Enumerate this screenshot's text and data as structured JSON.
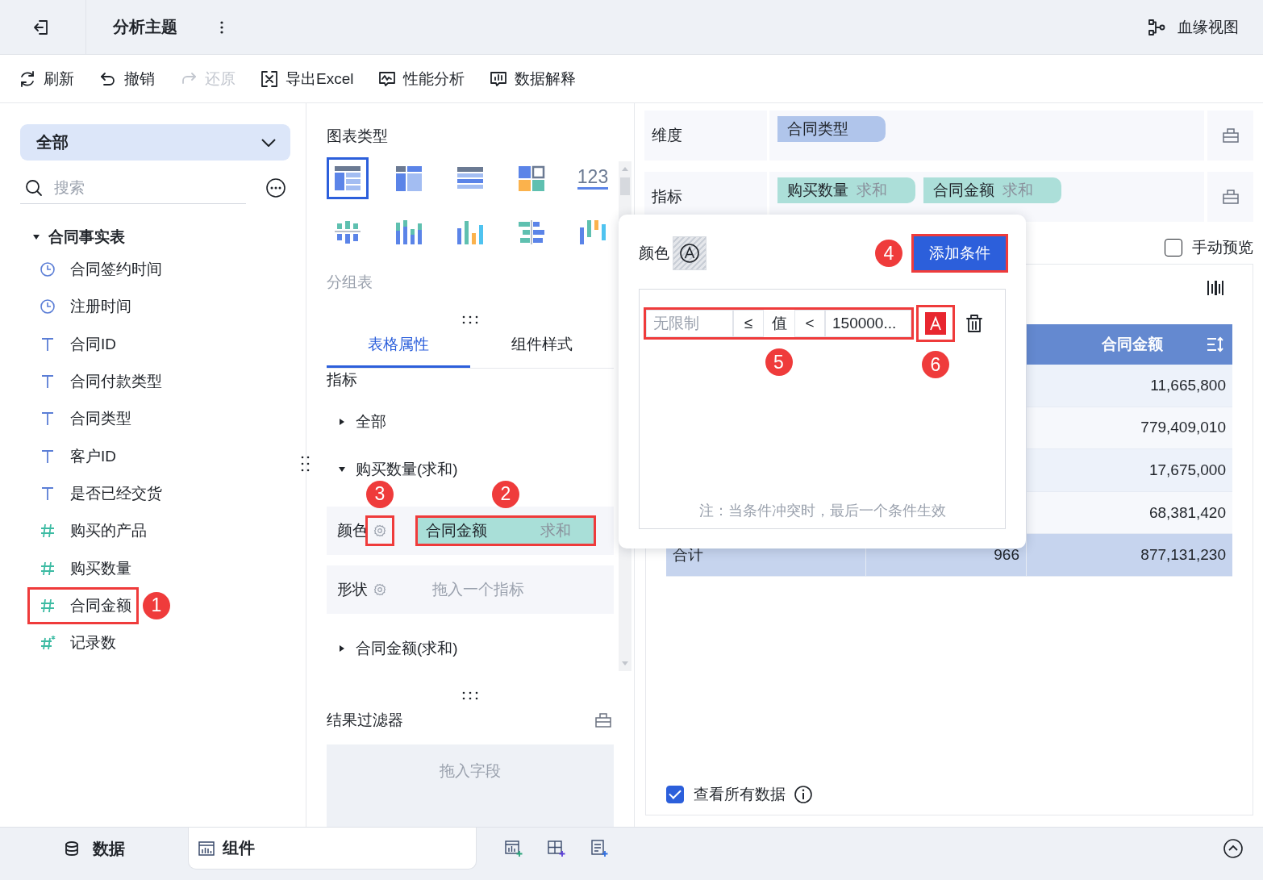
{
  "header": {
    "title": "分析主题",
    "lineage": "血缘视图"
  },
  "toolbar": [
    {
      "kind": "refresh",
      "label": "刷新",
      "disabled": false
    },
    {
      "kind": "undo",
      "label": "撤销",
      "disabled": false
    },
    {
      "kind": "redo",
      "label": "还原",
      "disabled": true
    },
    {
      "kind": "excel",
      "label": "导出Excel",
      "disabled": false
    },
    {
      "kind": "perf",
      "label": "性能分析",
      "disabled": false
    },
    {
      "kind": "explain",
      "label": "数据解释",
      "disabled": false
    }
  ],
  "fields_panel": {
    "scope": "全部",
    "search": {
      "placeholder": "搜索"
    },
    "tree": [
      {
        "label": "合同事实表",
        "expanded": true,
        "children": [
          {
            "label": "合同签约时间",
            "kind": "time"
          },
          {
            "label": "注册时间",
            "kind": "time"
          },
          {
            "label": "合同ID",
            "kind": "text"
          },
          {
            "label": "合同付款类型",
            "kind": "text"
          },
          {
            "label": "合同类型",
            "kind": "text"
          },
          {
            "label": "客户ID",
            "kind": "text"
          },
          {
            "label": "是否已经交货",
            "kind": "text"
          },
          {
            "label": "购买的产品",
            "kind": "number"
          },
          {
            "label": "购买数量",
            "kind": "number"
          },
          {
            "label": "合同金额",
            "kind": "number",
            "callout": "1"
          },
          {
            "label": "记录数",
            "kind": "calc"
          }
        ]
      }
    ]
  },
  "chart_types": {
    "title": "图表类型",
    "caption": "分组表",
    "items": [
      {
        "kind": "group-table",
        "selected": true
      },
      {
        "kind": "cross-table",
        "selected": false
      },
      {
        "kind": "detail-table",
        "selected": false
      },
      {
        "kind": "card",
        "selected": false
      },
      {
        "kind": "kpi",
        "label": "123",
        "selected": false
      },
      {
        "kind": "diverging",
        "selected": false
      },
      {
        "kind": "stacked",
        "selected": false
      },
      {
        "kind": "column",
        "selected": false
      },
      {
        "kind": "butterfly",
        "selected": false
      },
      {
        "kind": "waterfall",
        "selected": false
      }
    ]
  },
  "tabs": [
    {
      "label": "表格属性",
      "selected": true
    },
    {
      "label": "组件样式",
      "selected": false
    }
  ],
  "metrics": {
    "title": "指标",
    "items": [
      {
        "label": "全部",
        "expanded": false
      },
      {
        "label": "购买数量(求和)",
        "expanded": true,
        "properties": [
          {
            "label": "颜色",
            "callout": "3",
            "pill": {
              "field": "合同金额",
              "agg": "求和",
              "callout": "2"
            }
          },
          {
            "label": "形状",
            "placeholder": "拖入一个指标"
          }
        ]
      },
      {
        "label": "合同金额(求和)",
        "expanded": false
      }
    ]
  },
  "result_filter": {
    "title": "结果过滤器",
    "placeholder": "拖入字段"
  },
  "dimension": {
    "label": "维度",
    "pills": [
      {
        "field": "合同类型"
      }
    ]
  },
  "measure": {
    "label": "指标",
    "pills": [
      {
        "field": "购买数量",
        "agg": "求和"
      },
      {
        "field": "合同金额",
        "agg": "求和"
      }
    ]
  },
  "manual_preview": {
    "label": "手动预览",
    "checked": false
  },
  "table": {
    "column_3": "合同金额",
    "rows": [
      "11,665,800",
      "779,409,010",
      "17,675,000",
      "68,381,420"
    ],
    "total": {
      "label": "合计",
      "column_2": "966",
      "column_3": "877,131,230"
    }
  },
  "view_all": {
    "label": "查看所有数据",
    "checked": true
  },
  "popup": {
    "color_label": "颜色",
    "add_button": {
      "label": "添加条件",
      "callout": "4"
    },
    "conditions": [
      {
        "min": {
          "placeholder": "无限制"
        },
        "op1": "≤",
        "value_label": "值",
        "op2": "<",
        "max": "150000...",
        "callout": "5",
        "color": "#e8262f",
        "color_callout": "6"
      }
    ],
    "note": "注：当条件冲突时，最后一个条件生效"
  },
  "bottom_tabs": [
    {
      "label": "数据",
      "kind": "database",
      "selected": false
    },
    {
      "label": "组件",
      "kind": "chart",
      "selected": true
    }
  ]
}
